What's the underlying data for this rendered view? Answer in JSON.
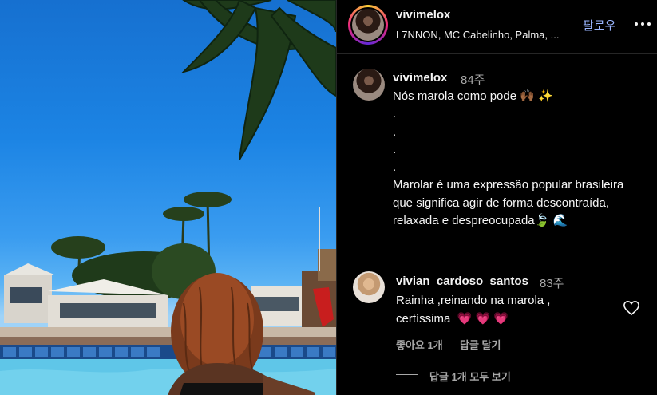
{
  "post": {
    "username": "vivimelox",
    "music": "L7NNON, MC Cabelinho, Palma, ...",
    "follow_label": "팔로우",
    "more_icon": "more-horizontal-icon"
  },
  "caption": {
    "username": "vivimelox",
    "time": "84주",
    "text": "Nós marola como pode 🙌🏾 ✨\n.\n.\n.\n.\nMarolar é uma expressão popular brasileira que significa agir de forma descontraída, relaxada e despreocupada🍃 🌊"
  },
  "comment": {
    "username": "vivian_cardoso_santos",
    "time": "83주",
    "text": "Rainha ,reinando na marola ,\ncertíssima  💗 💗 💗",
    "likes": "좋아요 1개",
    "reply_label": "답글 달기",
    "view_replies": "답글 1개 모두 보기"
  },
  "colors": {
    "follow": "#9ab6ff",
    "secondary_text": "#a8a8a8",
    "background": "#000000"
  }
}
